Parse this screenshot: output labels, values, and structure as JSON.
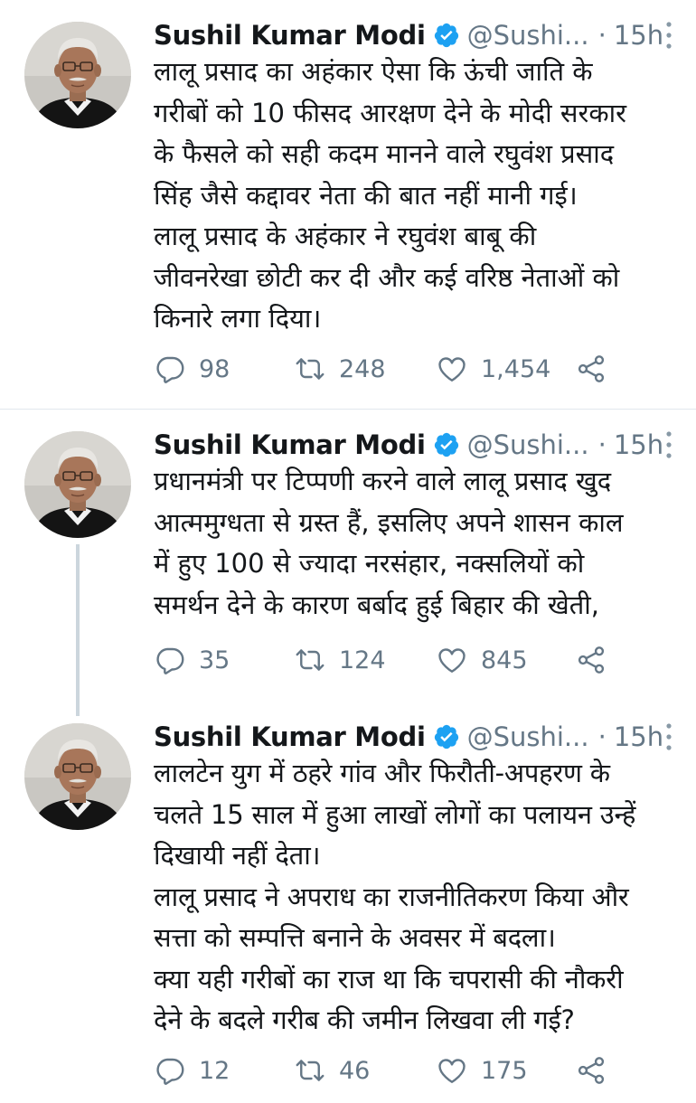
{
  "tweets": [
    {
      "author_name": "Sushil Kumar Modi",
      "handle": "@Sushi...",
      "separator": "·",
      "time": "15h",
      "text": "लालू प्रसाद का अहंकार ऐसा कि ऊंची जाति के\nगरीबों को 10 फीसद आरक्षण देने के मोदी सरकार\nके फैसले को सही कदम मानने वाले रघुवंश प्रसाद\nसिंह जैसे कद्दावर नेता की बात नहीं मानी गई।\n  लालू प्रसाद के अहंकार ने रघुवंश बाबू की\nजीवनरेखा छोटी कर दी और कई वरिष्ठ नेताओं को\nकिनारे लगा दिया।",
      "replies": "98",
      "retweets": "248",
      "likes": "1,454"
    },
    {
      "author_name": "Sushil Kumar Modi",
      "handle": "@Sushi...",
      "separator": "·",
      "time": "15h",
      "text": "प्रधानमंत्री पर टिप्पणी करने वाले लालू प्रसाद खुद\nआत्ममुग्धता से ग्रस्त हैं, इसलिए अपने शासन काल\nमें हुए 100 से ज्यादा नरसंहार, नक्सलियों को\nसमर्थन देने के कारण बर्बाद हुई बिहार की खेती,",
      "replies": "35",
      "retweets": "124",
      "likes": "845"
    },
    {
      "author_name": "Sushil Kumar Modi",
      "handle": "@Sushi...",
      "separator": "·",
      "time": "15h",
      "text": "लालटेन युग में ठहरे गांव और फिरौती-अपहरण के\nचलते 15 साल में हुआ लाखों लोगों का पलायन उन्हें\nदिखायी नहीं देता।\nलालू प्रसाद ने अपराध का राजनीतिकरण किया और\nसत्ता को सम्पत्ति बनाने के अवसर में बदला।\nक्या यही गरीबों का राज था कि चपरासी की नौकरी\nदेने के बदले गरीब की जमीन लिखवा ली गई?",
      "replies": "12",
      "retweets": "46",
      "likes": "175"
    }
  ],
  "icons": {
    "reply": "reply-icon",
    "retweet": "retweet-icon",
    "like": "heart-icon",
    "share": "share-icon",
    "verified": "verified-badge-icon",
    "more": "more-vertical-icon"
  },
  "colors": {
    "verified_blue": "#1da1f2",
    "muted_text": "#657786",
    "divider": "#e1e8ed",
    "thread_line": "#ccd6dd"
  }
}
